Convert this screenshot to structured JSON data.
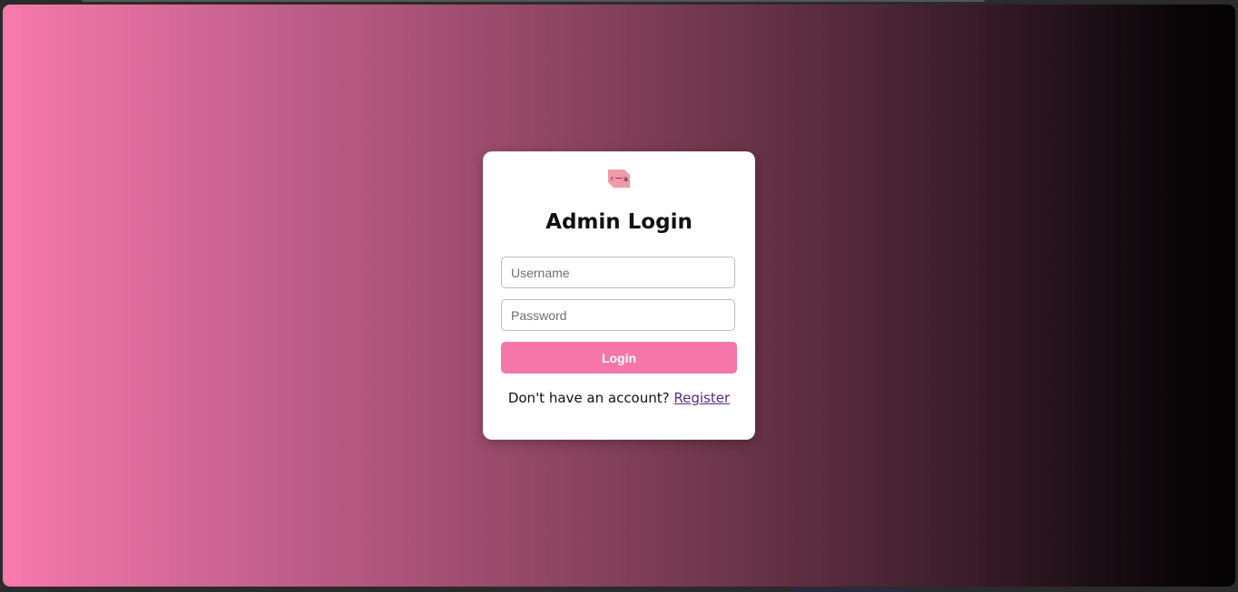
{
  "login_card": {
    "logo_icon": "brand-logo-icon",
    "title": "Admin Login",
    "username_placeholder": "Username",
    "username_value": "",
    "password_placeholder": "Password",
    "password_value": "",
    "login_label": "Login",
    "register_prompt": "Don't have an account?",
    "register_link": "Register"
  },
  "colors": {
    "gradient_start": "#f77aab",
    "gradient_end": "#050304",
    "button": "#f577aa",
    "link": "#5a2a86",
    "card_bg": "#ffffff"
  }
}
